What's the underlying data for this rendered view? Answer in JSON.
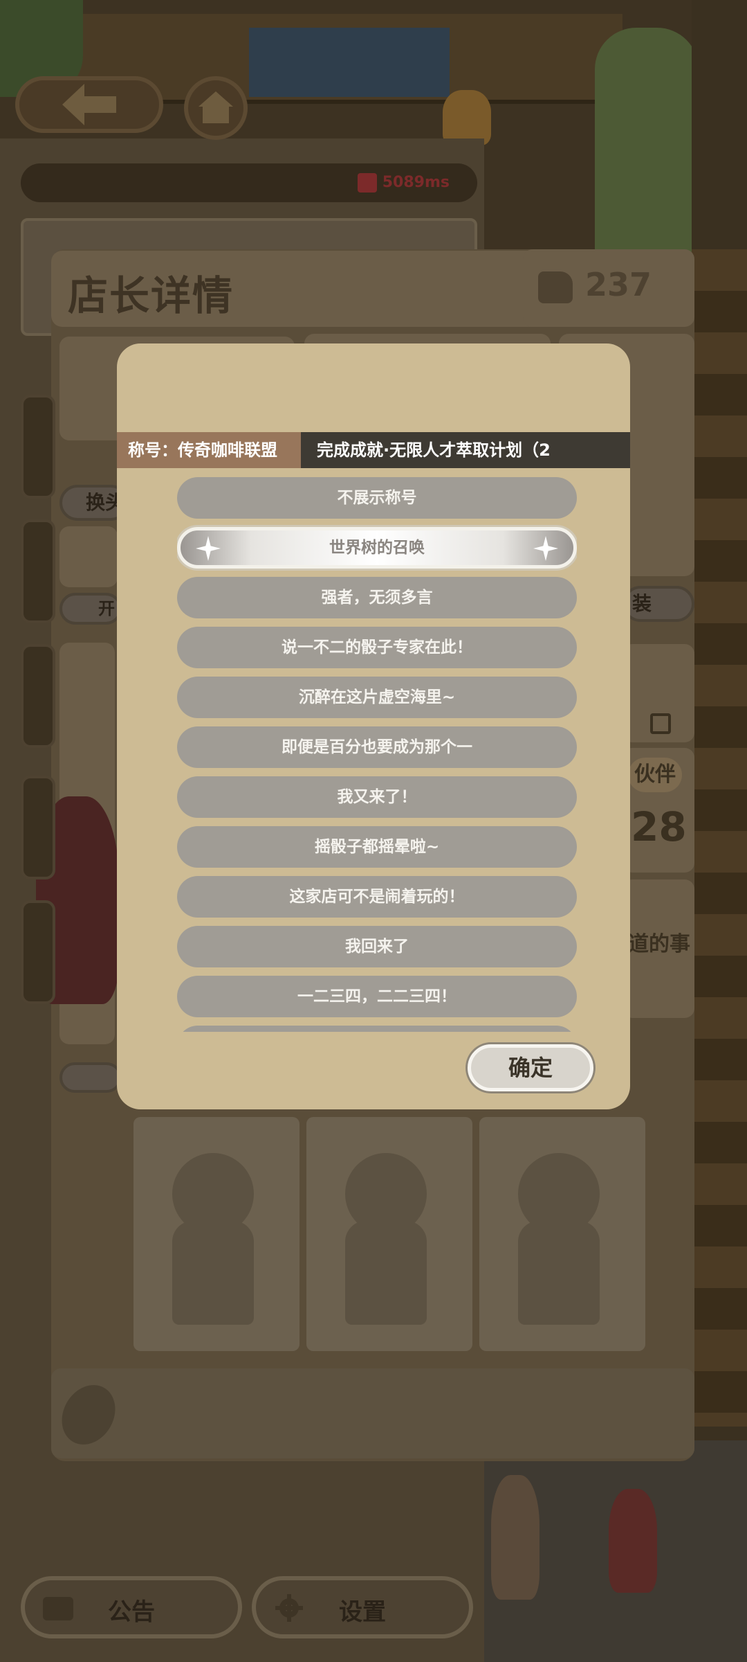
{
  "status": {
    "ping": "5089ms"
  },
  "profile": {
    "title": "店长详情",
    "likes": "237",
    "buttons": {
      "change_avatar": "换头",
      "open": "开",
      "outfit": "装"
    },
    "partner_label": "伙伴",
    "partner_count": "28",
    "note_snippet": "道的事"
  },
  "title_modal": {
    "current_label": "称号：传奇咖啡联盟",
    "current_achievement": "完成成就·无限人才萃取计划（2",
    "options": [
      {
        "label": "不展示称号",
        "selected": false
      },
      {
        "label": "世界树的召唤",
        "selected": true
      },
      {
        "label": "强者，无须多言",
        "selected": false
      },
      {
        "label": "说一不二的骰子专家在此！",
        "selected": false
      },
      {
        "label": "沉醉在这片虚空海里~",
        "selected": false
      },
      {
        "label": "即便是百分也要成为那个一",
        "selected": false
      },
      {
        "label": "我又来了！",
        "selected": false
      },
      {
        "label": "摇骰子都摇晕啦~",
        "selected": false
      },
      {
        "label": "这家店可不是闹着玩的！",
        "selected": false
      },
      {
        "label": "我回来了",
        "selected": false
      },
      {
        "label": "一二三四，二二三四！",
        "selected": false
      }
    ],
    "confirm_label": "确定"
  },
  "footer": {
    "notice_label": "公告",
    "settings_label": "设置"
  },
  "icons": {
    "back": "back-arrow-icon",
    "home": "home-icon",
    "signal": "signal-icon",
    "like": "thumbs-up-icon",
    "edit": "edit-icon",
    "notice": "briefcase-icon",
    "settings": "gear-icon",
    "coffee": "coffee-bean-icon"
  }
}
